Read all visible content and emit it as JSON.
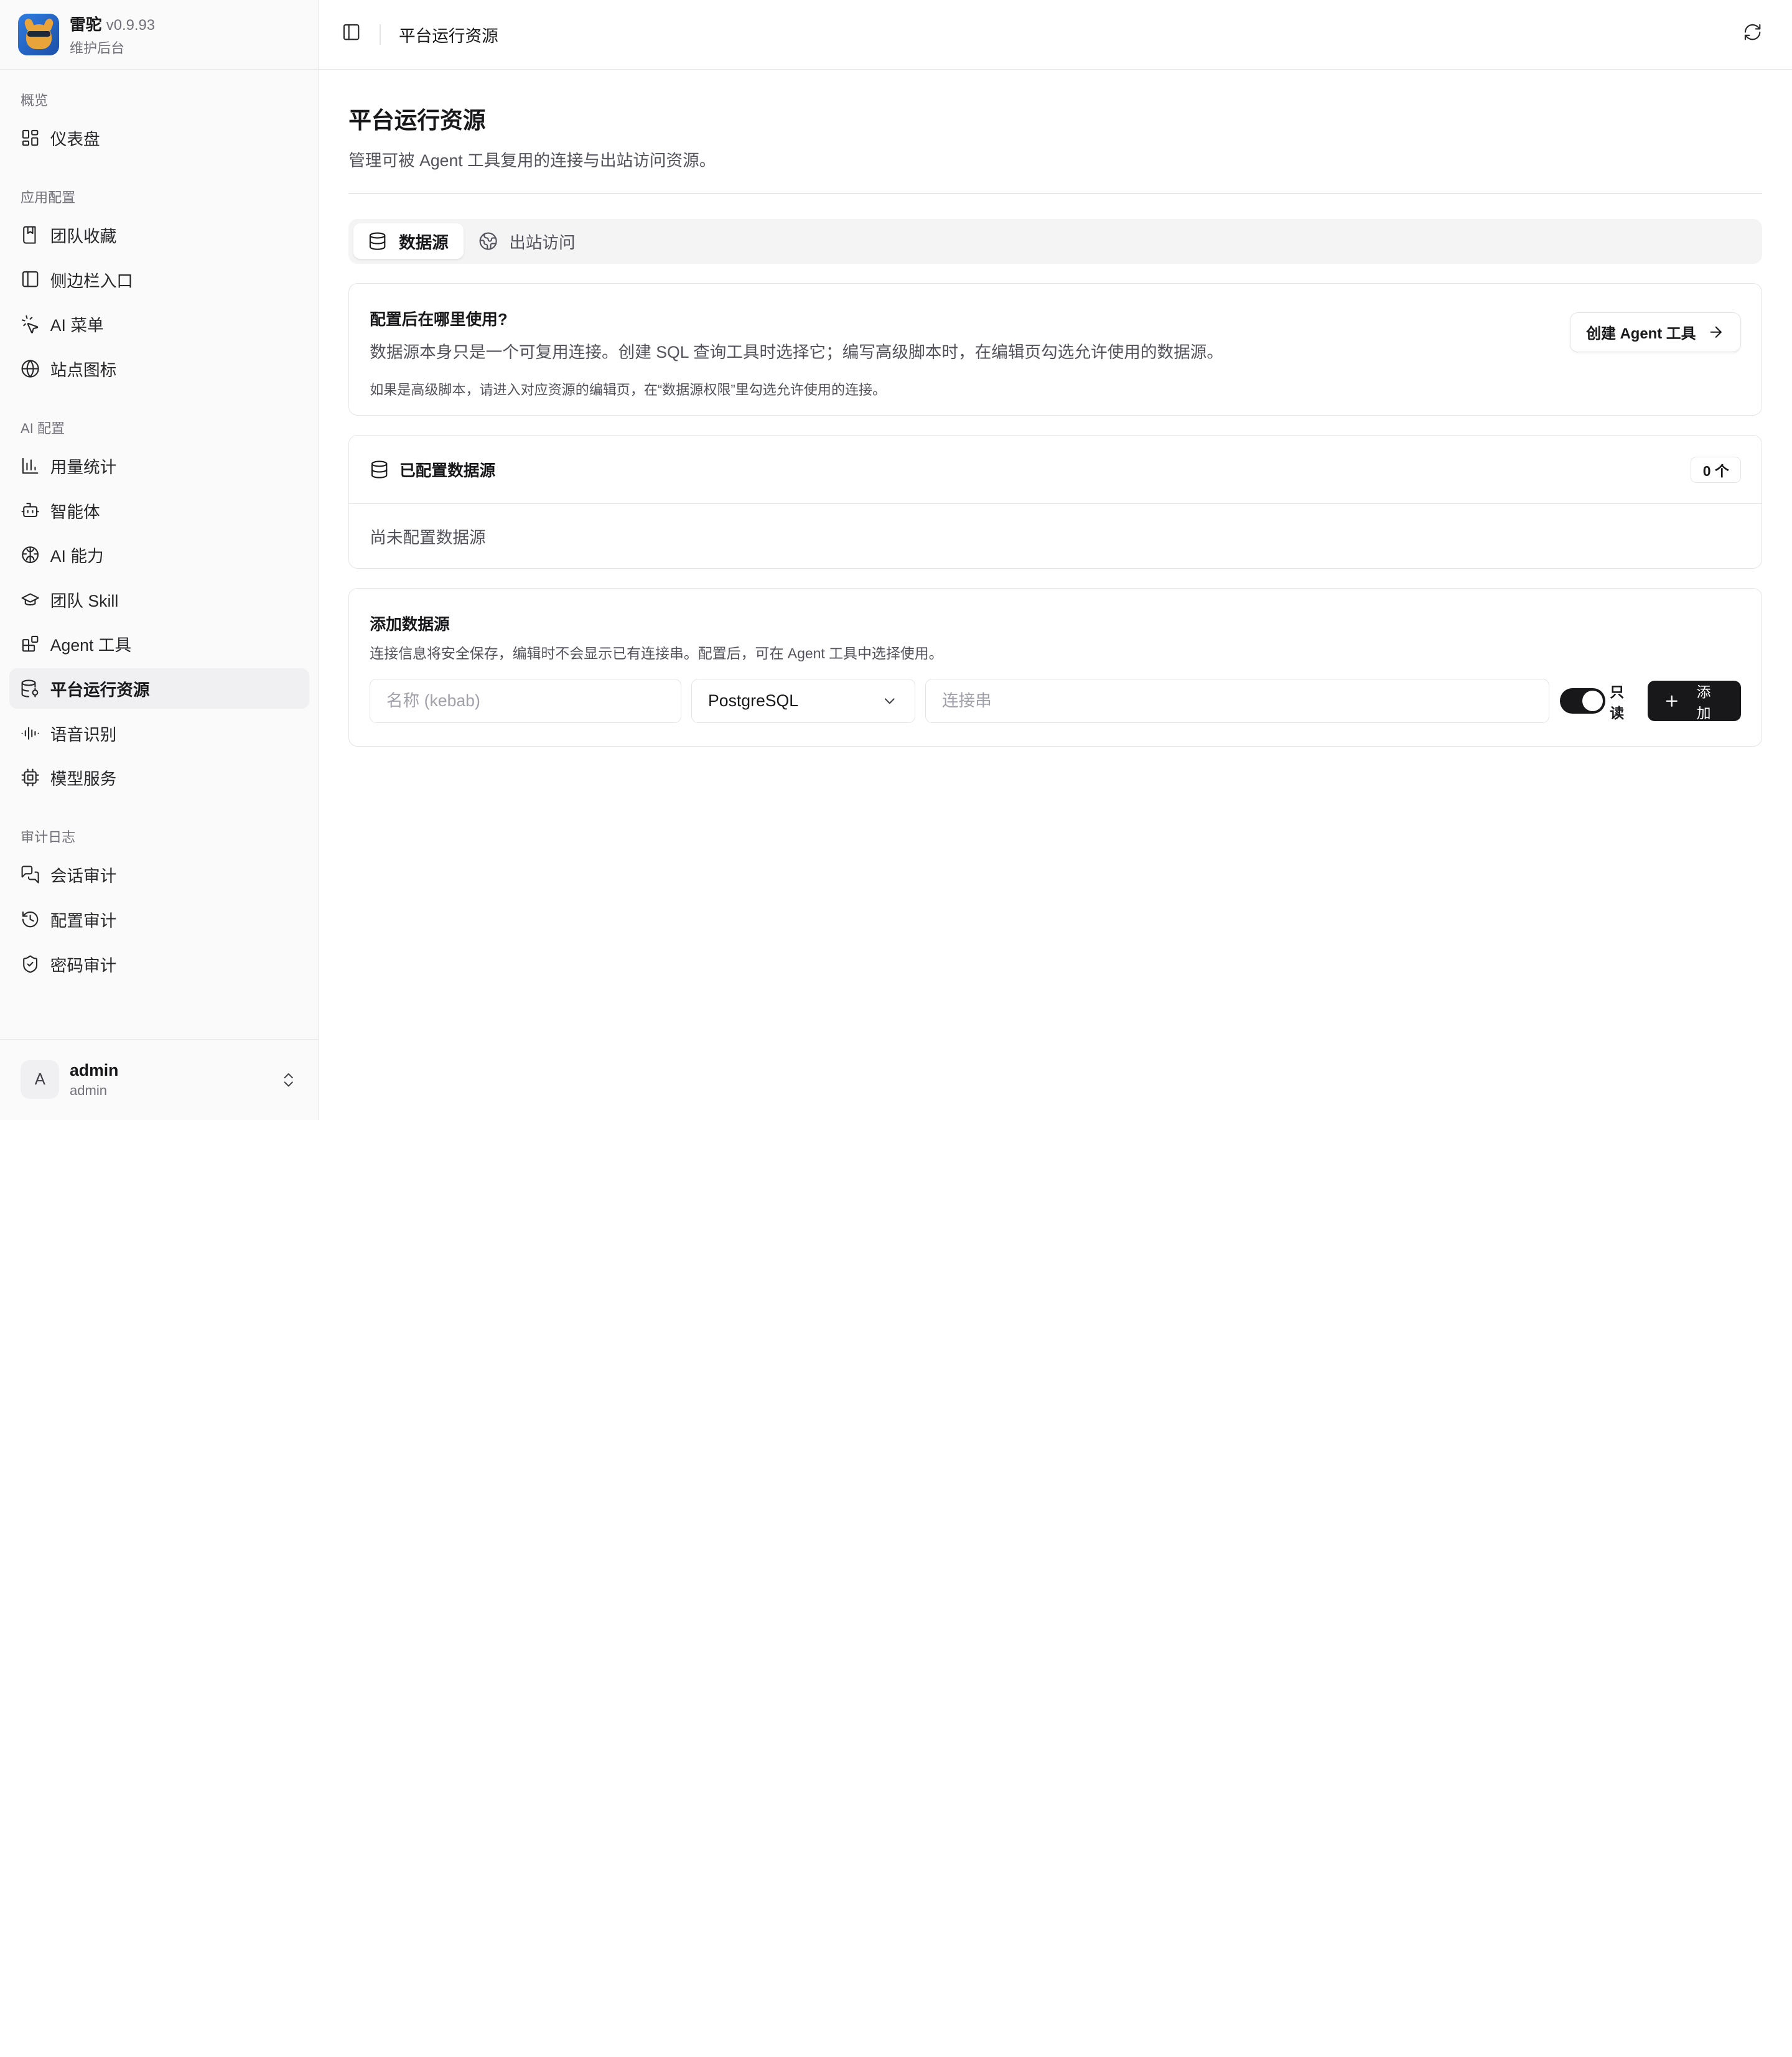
{
  "brand": {
    "name": "雷驼",
    "version": "v0.9.93",
    "subtitle": "维护后台"
  },
  "nav": {
    "groups": [
      {
        "label": "概览",
        "items": [
          {
            "label": "仪表盘",
            "icon": "dashboard-icon"
          }
        ]
      },
      {
        "label": "应用配置",
        "items": [
          {
            "label": "团队收藏",
            "icon": "bookmark-icon"
          },
          {
            "label": "侧边栏入口",
            "icon": "sidebar-icon"
          },
          {
            "label": "AI 菜单",
            "icon": "sparkle-pointer-icon"
          },
          {
            "label": "站点图标",
            "icon": "globe-icon"
          }
        ]
      },
      {
        "label": "AI 配置",
        "items": [
          {
            "label": "用量统计",
            "icon": "bar-chart-icon"
          },
          {
            "label": "智能体",
            "icon": "bot-icon"
          },
          {
            "label": "AI 能力",
            "icon": "brain-icon"
          },
          {
            "label": "团队 Skill",
            "icon": "graduation-cap-icon"
          },
          {
            "label": "Agent 工具",
            "icon": "blocks-icon"
          },
          {
            "label": "平台运行资源",
            "icon": "database-cog-icon",
            "active": true
          },
          {
            "label": "语音识别",
            "icon": "audio-waveform-icon"
          },
          {
            "label": "模型服务",
            "icon": "cpu-icon"
          }
        ]
      },
      {
        "label": "审计日志",
        "items": [
          {
            "label": "会话审计",
            "icon": "messages-icon"
          },
          {
            "label": "配置审计",
            "icon": "history-icon"
          },
          {
            "label": "密码审计",
            "icon": "shield-check-icon"
          }
        ]
      }
    ]
  },
  "user": {
    "initial": "A",
    "name": "admin",
    "role": "admin"
  },
  "topbar": {
    "breadcrumb": "平台运行资源"
  },
  "page": {
    "title": "平台运行资源",
    "description": "管理可被 Agent 工具复用的连接与出站访问资源。"
  },
  "tabs": [
    {
      "label": "数据源",
      "active": true
    },
    {
      "label": "出站访问",
      "active": false
    }
  ],
  "info_card": {
    "title": "配置后在哪里使用?",
    "text": "数据源本身只是一个可复用连接。创建 SQL 查询工具时选择它；编写高级脚本时，在编辑页勾选允许使用的数据源。",
    "note": "如果是高级脚本，请进入对应资源的编辑页，在“数据源权限”里勾选允许使用的连接。",
    "button_label": "创建 Agent 工具"
  },
  "configured": {
    "title": "已配置数据源",
    "count": "0 个",
    "empty_text": "尚未配置数据源"
  },
  "add_form": {
    "title": "添加数据源",
    "description": "连接信息将安全保存，编辑时不会显示已有连接串。配置后，可在 Agent 工具中选择使用。",
    "name_placeholder": "名称 (kebab)",
    "type_value": "PostgreSQL",
    "conn_placeholder": "连接串",
    "readonly_label": "只读",
    "add_label": "添加"
  }
}
